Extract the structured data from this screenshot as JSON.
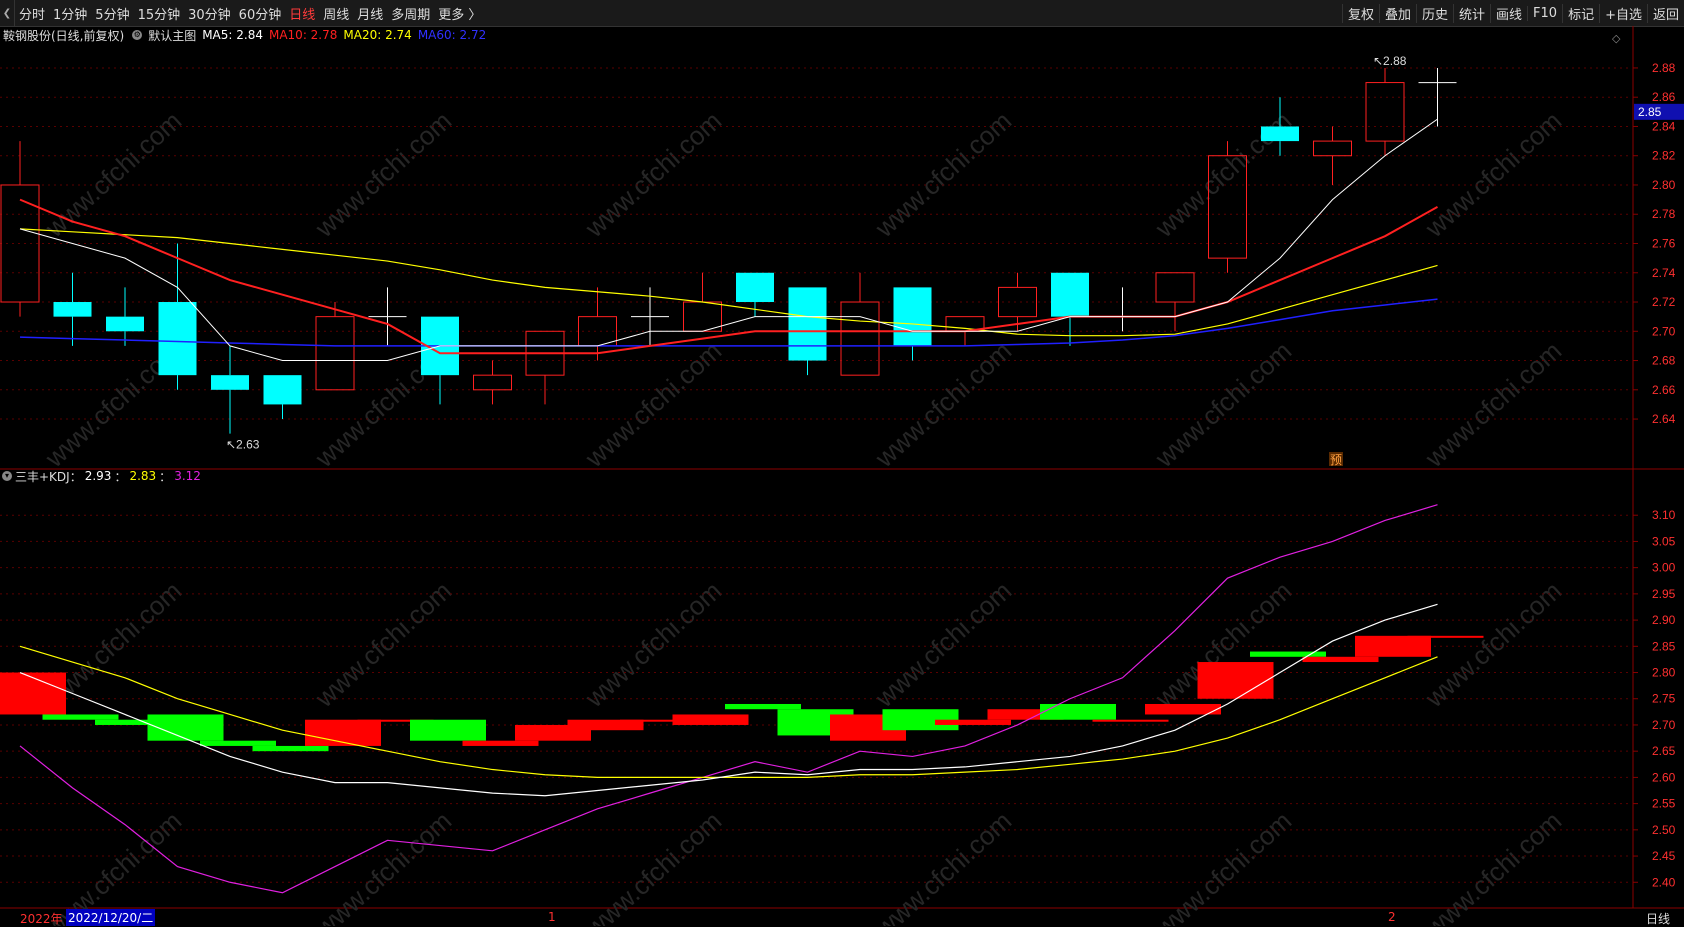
{
  "toolbar": {
    "periods": [
      "分时",
      "1分钟",
      "5分钟",
      "15分钟",
      "30分钟",
      "60分钟",
      "日线",
      "周线",
      "月线",
      "多周期",
      "更多 〉"
    ],
    "active_period": "日线",
    "right_buttons": [
      "复权",
      "叠加",
      "历史",
      "统计",
      "画线",
      "F10",
      "标记",
      "+自选",
      "返回"
    ]
  },
  "infobar": {
    "stock_name": "鞍钢股份(日线,前复权)",
    "main_chart_label": "默认主图",
    "ma5": "MA5: 2.84",
    "ma10": "MA10: 2.78",
    "ma20": "MA20: 2.74",
    "ma60": "MA60: 2.72"
  },
  "kdjbar": {
    "label": "三丰+KDJ：",
    "v1": "2.93",
    "sep1": "：",
    "v2": "2.83",
    "sep2": "：",
    "v3": "3.12"
  },
  "price_labels": {
    "high": "2.88",
    "low": "2.63",
    "current": "2.85",
    "forecast_badge": "预"
  },
  "bottom": {
    "year": "2022年",
    "date": "2022/12/20/二",
    "tick1": "1",
    "tick2": "2",
    "period_label": "日线"
  },
  "watermark": "www.cfchi.com",
  "colors": {
    "up": "#ff2020",
    "down": "#00ffff",
    "ma5": "#ffffff",
    "ma10": "#ff2020",
    "ma20": "#ffff00",
    "ma60": "#2020ff",
    "kdj_up": "#ff0000",
    "kdj_down": "#00ff00",
    "kdj_line3": "#e020e0"
  },
  "chart_data": {
    "type": "candlestick",
    "price_axis": {
      "ticks": [
        "2.88",
        "2.86",
        "2.84",
        "2.82",
        "2.80",
        "2.78",
        "2.76",
        "2.74",
        "2.72",
        "2.70",
        "2.68",
        "2.66",
        "2.64"
      ],
      "range": [
        2.625,
        2.895
      ]
    },
    "indicator_axis": {
      "ticks": [
        "3.10",
        "3.05",
        "3.00",
        "2.95",
        "2.90",
        "2.85",
        "2.80",
        "2.75",
        "2.70",
        "2.65",
        "2.60",
        "2.55",
        "2.50",
        "2.45",
        "2.40"
      ],
      "range": [
        2.37,
        3.15
      ]
    },
    "candles": [
      {
        "o": 2.72,
        "c": 2.8,
        "h": 2.83,
        "l": 2.71
      },
      {
        "o": 2.72,
        "c": 2.71,
        "h": 2.74,
        "l": 2.69
      },
      {
        "o": 2.71,
        "c": 2.7,
        "h": 2.73,
        "l": 2.69
      },
      {
        "o": 2.72,
        "c": 2.67,
        "h": 2.76,
        "l": 2.66
      },
      {
        "o": 2.67,
        "c": 2.66,
        "h": 2.69,
        "l": 2.63
      },
      {
        "o": 2.67,
        "c": 2.65,
        "h": 2.67,
        "l": 2.64
      },
      {
        "o": 2.66,
        "c": 2.71,
        "h": 2.72,
        "l": 2.66
      },
      {
        "o": 2.71,
        "c": 2.71,
        "h": 2.73,
        "l": 2.69
      },
      {
        "o": 2.71,
        "c": 2.67,
        "h": 2.71,
        "l": 2.65
      },
      {
        "o": 2.66,
        "c": 2.67,
        "h": 2.68,
        "l": 2.65
      },
      {
        "o": 2.67,
        "c": 2.7,
        "h": 2.7,
        "l": 2.65
      },
      {
        "o": 2.69,
        "c": 2.71,
        "h": 2.73,
        "l": 2.68
      },
      {
        "o": 2.71,
        "c": 2.71,
        "h": 2.73,
        "l": 2.69
      },
      {
        "o": 2.7,
        "c": 2.72,
        "h": 2.74,
        "l": 2.7
      },
      {
        "o": 2.74,
        "c": 2.72,
        "h": 2.74,
        "l": 2.71
      },
      {
        "o": 2.73,
        "c": 2.68,
        "h": 2.73,
        "l": 2.67
      },
      {
        "o": 2.67,
        "c": 2.72,
        "h": 2.74,
        "l": 2.67
      },
      {
        "o": 2.73,
        "c": 2.69,
        "h": 2.73,
        "l": 2.68
      },
      {
        "o": 2.7,
        "c": 2.71,
        "h": 2.71,
        "l": 2.69
      },
      {
        "o": 2.71,
        "c": 2.73,
        "h": 2.74,
        "l": 2.7
      },
      {
        "o": 2.74,
        "c": 2.71,
        "h": 2.74,
        "l": 2.69
      },
      {
        "o": 2.71,
        "c": 2.71,
        "h": 2.73,
        "l": 2.7
      },
      {
        "o": 2.72,
        "c": 2.74,
        "h": 2.74,
        "l": 2.7
      },
      {
        "o": 2.75,
        "c": 2.82,
        "h": 2.83,
        "l": 2.74
      },
      {
        "o": 2.84,
        "c": 2.83,
        "h": 2.86,
        "l": 2.82
      },
      {
        "o": 2.82,
        "c": 2.83,
        "h": 2.84,
        "l": 2.8
      },
      {
        "o": 2.83,
        "c": 2.87,
        "h": 2.88,
        "l": 2.82
      },
      {
        "o": 2.87,
        "c": 2.87,
        "h": 2.88,
        "l": 2.84
      }
    ],
    "ma5": [
      2.77,
      2.76,
      2.75,
      2.73,
      2.69,
      2.68,
      2.68,
      2.68,
      2.69,
      2.69,
      2.69,
      2.69,
      2.7,
      2.7,
      2.71,
      2.71,
      2.71,
      2.7,
      2.7,
      2.7,
      2.71,
      2.71,
      2.71,
      2.72,
      2.75,
      2.79,
      2.82,
      2.845
    ],
    "ma10": [
      2.79,
      2.775,
      2.765,
      2.75,
      2.735,
      2.725,
      2.715,
      2.705,
      2.685,
      2.685,
      2.685,
      2.685,
      2.69,
      2.695,
      2.7,
      2.7,
      2.7,
      2.7,
      2.7,
      2.705,
      2.71,
      2.71,
      2.71,
      2.72,
      2.735,
      2.75,
      2.765,
      2.785
    ],
    "ma20": [
      2.77,
      2.768,
      2.766,
      2.764,
      2.76,
      2.756,
      2.752,
      2.748,
      2.742,
      2.735,
      2.73,
      2.727,
      2.724,
      2.72,
      2.715,
      2.71,
      2.707,
      2.705,
      2.702,
      2.698,
      2.697,
      2.697,
      2.698,
      2.705,
      2.715,
      2.725,
      2.735,
      2.745
    ],
    "ma60": [
      2.696,
      2.695,
      2.694,
      2.693,
      2.692,
      2.691,
      2.69,
      2.69,
      2.69,
      2.69,
      2.69,
      2.69,
      2.69,
      2.69,
      2.69,
      2.69,
      2.69,
      2.69,
      2.69,
      2.691,
      2.692,
      2.694,
      2.697,
      2.702,
      2.708,
      2.714,
      2.718,
      2.722
    ],
    "kdj_bars": [
      {
        "o": 2.72,
        "c": 2.8
      },
      {
        "o": 2.72,
        "c": 2.71
      },
      {
        "o": 2.71,
        "c": 2.7
      },
      {
        "o": 2.72,
        "c": 2.67
      },
      {
        "o": 2.67,
        "c": 2.66
      },
      {
        "o": 2.66,
        "c": 2.65
      },
      {
        "o": 2.66,
        "c": 2.71
      },
      {
        "o": 2.71,
        "c": 2.71
      },
      {
        "o": 2.71,
        "c": 2.67
      },
      {
        "o": 2.66,
        "c": 2.67
      },
      {
        "o": 2.67,
        "c": 2.7
      },
      {
        "o": 2.69,
        "c": 2.71
      },
      {
        "o": 2.71,
        "c": 2.71
      },
      {
        "o": 2.7,
        "c": 2.72
      },
      {
        "o": 2.74,
        "c": 2.73
      },
      {
        "o": 2.73,
        "c": 2.68
      },
      {
        "o": 2.67,
        "c": 2.72
      },
      {
        "o": 2.73,
        "c": 2.69
      },
      {
        "o": 2.7,
        "c": 2.71
      },
      {
        "o": 2.71,
        "c": 2.73
      },
      {
        "o": 2.74,
        "c": 2.71
      },
      {
        "o": 2.71,
        "c": 2.71
      },
      {
        "o": 2.72,
        "c": 2.74
      },
      {
        "o": 2.75,
        "c": 2.82
      },
      {
        "o": 2.84,
        "c": 2.83
      },
      {
        "o": 2.82,
        "c": 2.83
      },
      {
        "o": 2.83,
        "c": 2.87
      },
      {
        "o": 2.87,
        "c": 2.87
      }
    ],
    "kdj_line1": [
      2.8,
      2.76,
      2.72,
      2.68,
      2.64,
      2.61,
      2.59,
      2.59,
      2.58,
      2.57,
      2.565,
      2.575,
      2.585,
      2.595,
      2.61,
      2.605,
      2.615,
      2.615,
      2.62,
      2.63,
      2.64,
      2.66,
      2.69,
      2.74,
      2.8,
      2.86,
      2.9,
      2.93
    ],
    "kdj_line2": [
      2.85,
      2.82,
      2.79,
      2.75,
      2.72,
      2.69,
      2.67,
      2.65,
      2.63,
      2.615,
      2.605,
      2.6,
      2.6,
      2.6,
      2.6,
      2.6,
      2.605,
      2.605,
      2.61,
      2.615,
      2.625,
      2.635,
      2.65,
      2.675,
      2.71,
      2.75,
      2.79,
      2.83
    ],
    "kdj_line3": [
      2.66,
      2.58,
      2.51,
      2.43,
      2.4,
      2.38,
      2.43,
      2.48,
      2.47,
      2.46,
      2.5,
      2.54,
      2.57,
      2.6,
      2.63,
      2.61,
      2.65,
      2.64,
      2.66,
      2.7,
      2.75,
      2.79,
      2.88,
      2.98,
      3.02,
      3.05,
      3.09,
      3.12
    ]
  }
}
